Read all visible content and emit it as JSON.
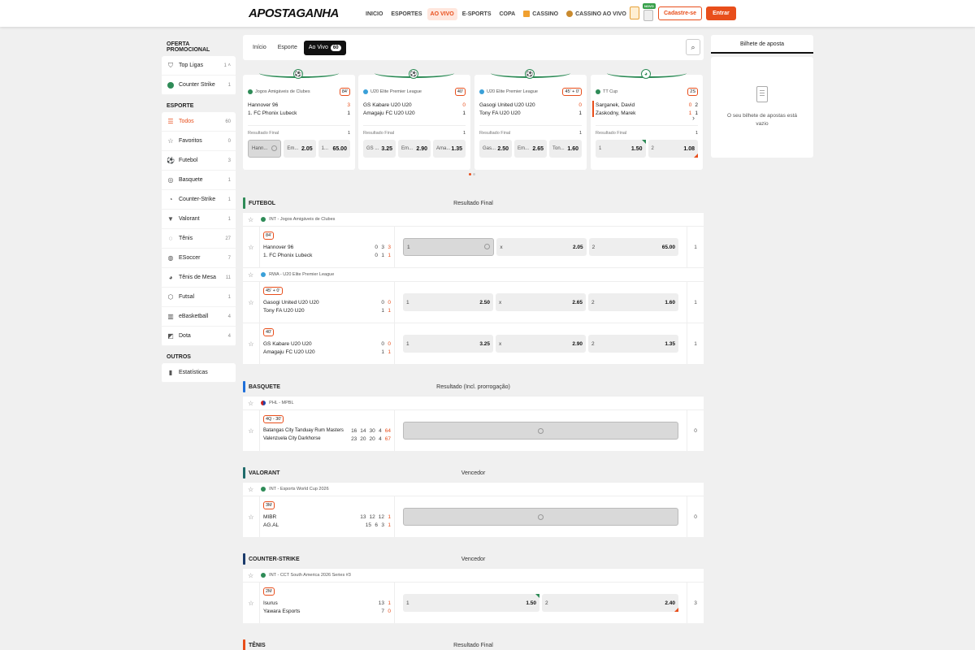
{
  "header": {
    "logo": "APOSTAGANHA",
    "nav": [
      {
        "label": "INICIO",
        "active": false
      },
      {
        "label": "ESPORTES",
        "active": false
      },
      {
        "label": "AO VIVO",
        "active": true
      },
      {
        "label": "E-SPORTS",
        "active": false
      },
      {
        "label": "COPA",
        "active": false
      },
      {
        "label": "CASSINO",
        "active": false
      },
      {
        "label": "CASSINO AO VIVO",
        "active": false
      }
    ],
    "novo_badge": "NOVO",
    "register_label": "Cadastre-se",
    "login_label": "Entrar",
    "accent": "#e84e1b"
  },
  "sidebar": {
    "promo_title": "OFERTA PROMOCIONAL",
    "promo_items": [
      {
        "label": "Top Ligas",
        "count": "1",
        "icon": "shield-icon"
      },
      {
        "label": "Counter Strike",
        "count": "1",
        "icon": "globe-icon"
      }
    ],
    "sport_title": "ESPORTE",
    "sport_items": [
      {
        "label": "Todos",
        "count": "60",
        "icon": "list-icon"
      },
      {
        "label": "Favoritos",
        "count": "0",
        "icon": "star-icon"
      },
      {
        "label": "Futebol",
        "count": "3",
        "icon": "soccer-ball-icon"
      },
      {
        "label": "Basquete",
        "count": "1",
        "icon": "basketball-icon"
      },
      {
        "label": "Counter-Strike",
        "count": "1",
        "icon": "counter-strike-icon"
      },
      {
        "label": "Valorant",
        "count": "1",
        "icon": "valorant-icon"
      },
      {
        "label": "Tênis",
        "count": "27",
        "icon": "tennis-ball-icon"
      },
      {
        "label": "ESoccer",
        "count": "7",
        "icon": "esoccer-icon"
      },
      {
        "label": "Tênis de Mesa",
        "count": "11",
        "icon": "table-tennis-icon"
      },
      {
        "label": "Futsal",
        "count": "1",
        "icon": "futsal-icon"
      },
      {
        "label": "eBasketball",
        "count": "4",
        "icon": "ebasketball-icon"
      },
      {
        "label": "Dota",
        "count": "4",
        "icon": "dota-icon"
      }
    ],
    "others_title": "OUTROS",
    "others_items": [
      {
        "label": "Estatísticas",
        "icon": "stats-icon"
      }
    ]
  },
  "tabs": {
    "inicio": "Início",
    "esporte": "Esporte",
    "aovivo": "Ao Vivo",
    "aovivo_count": "60"
  },
  "cards": [
    {
      "league": "Jogos Amigáveis de Clubes",
      "time": "84'",
      "home": "Hannover 96",
      "away": "1. FC Phonix Lubeck",
      "home_score": "3",
      "away_score": "1",
      "market": "Resultado Final",
      "market_count": "1",
      "odds": [
        {
          "l": "Hann...",
          "v": ""
        },
        {
          "l": "Em...",
          "v": "2.05"
        },
        {
          "l": "1...",
          "v": "65.00"
        }
      ]
    },
    {
      "league": "U20 Elite Premier League",
      "time": "40'",
      "home": "GS Kabare U20 U20",
      "away": "Amagaju FC U20 U20",
      "home_score": "0",
      "away_score": "1",
      "market": "Resultado Final",
      "market_count": "1",
      "odds": [
        {
          "l": "GS ...",
          "v": "3.25"
        },
        {
          "l": "Em...",
          "v": "2.90"
        },
        {
          "l": "Ama...",
          "v": "1.35"
        }
      ]
    },
    {
      "league": "U20 Elite Premier League",
      "time": "45' + 0'",
      "home": "Gasogi United U20 U20",
      "away": "Tony FA U20 U20",
      "home_score": "0",
      "away_score": "1",
      "market": "Resultado Final",
      "market_count": "1",
      "odds": [
        {
          "l": "Gas...",
          "v": "2.50"
        },
        {
          "l": "Em...",
          "v": "2.65"
        },
        {
          "l": "Ton...",
          "v": "1.60"
        }
      ]
    },
    {
      "league": "TT Cup",
      "time": "2S",
      "home": "Sarganek, David",
      "away": "Zaskodny, Marek",
      "home_score": "0",
      "away_score": "1",
      "home_score2": "2",
      "away_score2": "1",
      "market": "Resultado Final",
      "market_count": "1",
      "odds": [
        {
          "l": "1",
          "v": "1.50"
        },
        {
          "l": "2",
          "v": "1.08"
        }
      ]
    }
  ],
  "sections": {
    "futebol": {
      "title": "FUTEBOL",
      "market": "Resultado Final",
      "color": "#2e8b57",
      "league1": "INT - Jogos Amigáveis de Clubes",
      "m1": {
        "time": "84'",
        "home": "Hannover 96",
        "away": "1. FC Phonix Lubeck",
        "hs": [
          "0",
          "3",
          "3"
        ],
        "as": [
          "0",
          "1",
          "1"
        ],
        "o1l": "1",
        "o2l": "x",
        "o2": "2.05",
        "o3l": "2",
        "o3": "65.00",
        "more": "1"
      },
      "league2": "RWA - U20 Elite Premier League",
      "m2": {
        "time": "45' + 0'",
        "home": "Gasogi United U20 U20",
        "away": "Tony FA U20 U20",
        "hs": [
          "0",
          "0"
        ],
        "as": [
          "1",
          "1"
        ],
        "o1l": "1",
        "o1": "2.50",
        "o2l": "x",
        "o2": "2.65",
        "o3l": "2",
        "o3": "1.60",
        "more": "1"
      },
      "m3": {
        "time": "40'",
        "home": "GS Kabare U20 U20",
        "away": "Amagaju FC U20 U20",
        "hs": [
          "0",
          "0"
        ],
        "as": [
          "1",
          "1"
        ],
        "o1l": "1",
        "o1": "3.25",
        "o2l": "x",
        "o2": "2.90",
        "o3l": "2",
        "o3": "1.35",
        "more": "1"
      }
    },
    "basquete": {
      "title": "BASQUETE",
      "market": "Resultado (Incl. prorrogação)",
      "color": "#1e6fd9",
      "league": "PHL - MPBL",
      "m": {
        "time": "4Q - 30'",
        "home": "Batangas City Tanduay Rum Masters",
        "away": "Valenzuela City Darkhorse",
        "hs": [
          "16",
          "14",
          "30",
          "4",
          "64"
        ],
        "as": [
          "23",
          "20",
          "20",
          "4",
          "67"
        ],
        "more": "0"
      }
    },
    "valorant": {
      "title": "VALORANT",
      "market": "Vencedor",
      "color": "#1f6b6b",
      "league": "INT - Esports World Cup 2026",
      "m": {
        "time": "3M",
        "home": "MIBR",
        "away": "AG.AL",
        "hs": [
          "13",
          "12",
          "12",
          "1"
        ],
        "as": [
          "15",
          "6",
          "3",
          "1"
        ],
        "more": "0"
      }
    },
    "counter": {
      "title": "COUNTER-STRIKE",
      "market": "Vencedor",
      "color": "#1a3a6b",
      "league": "INT - CCT South America 2026 Series #3",
      "m": {
        "time": "2M",
        "home": "Isurus",
        "away": "Yawara Esports",
        "hs": [
          "13",
          "1"
        ],
        "as": [
          "7",
          "0"
        ],
        "o1l": "1",
        "o1": "1.50",
        "o2l": "2",
        "o2": "2.40",
        "more": "3"
      }
    },
    "tenis": {
      "title": "TÊNIS",
      "market": "Resultado Final",
      "color": "#e84e1b"
    }
  },
  "betslip": {
    "title": "Bilhete de aposta",
    "empty_text": "O seu bilhete de apostas está vazio"
  }
}
